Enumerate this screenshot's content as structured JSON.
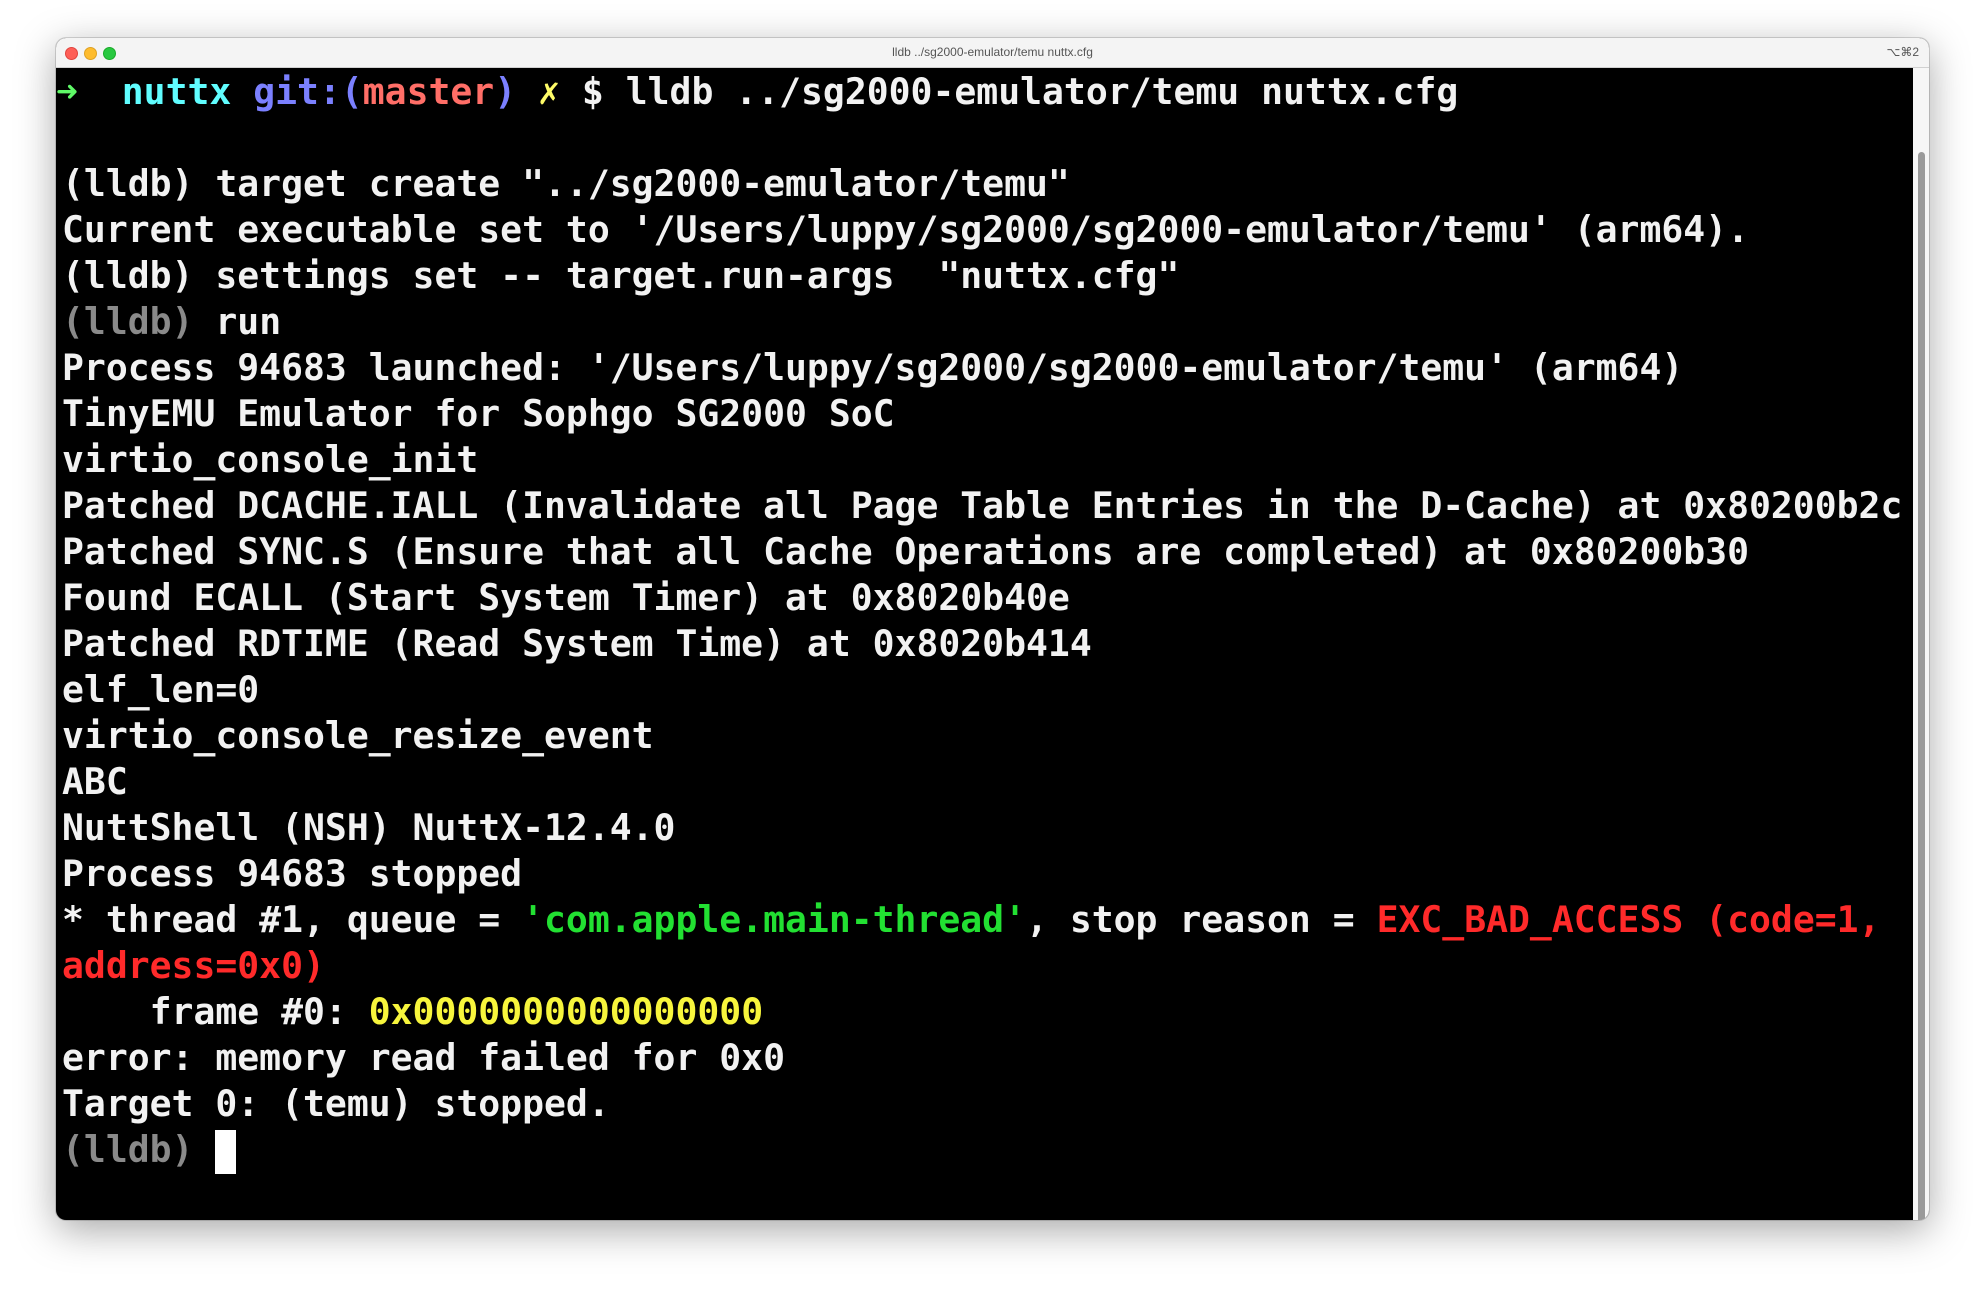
{
  "window": {
    "title": "lldb ../sg2000-emulator/temu nuttx.cfg",
    "shortcut": "⌥⌘2"
  },
  "colors": {
    "prompt_arrow": "#5ff967",
    "dir": "#60fdff",
    "git": "#7b80ff",
    "branch": "#ff6e67",
    "dirty": "#fefb67",
    "dim": "#8a8a8a",
    "string": "#22e032",
    "error": "#ff2a2a",
    "address": "#f7f53c"
  },
  "prompt": {
    "arrow": "➜",
    "dir": "nuttx",
    "git_open": "git:(",
    "branch": "master",
    "git_close": ")",
    "dirty": "✗",
    "command": "$ lldb ../sg2000-emulator/temu nuttx.cfg"
  },
  "lines": [
    "(lldb) target create \"../sg2000-emulator/temu\"",
    "Current executable set to '/Users/luppy/sg2000/sg2000-emulator/temu' (arm64).",
    "(lldb) settings set -- target.run-args  \"nuttx.cfg\""
  ],
  "run_line": {
    "prompt": "(lldb)",
    "cmd": " run"
  },
  "output": [
    "Process 94683 launched: '/Users/luppy/sg2000/sg2000-emulator/temu' (arm64)",
    "TinyEMU Emulator for Sophgo SG2000 SoC",
    "virtio_console_init",
    "Patched DCACHE.IALL (Invalidate all Page Table Entries in the D-Cache) at 0x80200b2c",
    "Patched SYNC.S (Ensure that all Cache Operations are completed) at 0x80200b30",
    "Found ECALL (Start System Timer) at 0x8020b40e",
    "Patched RDTIME (Read System Time) at 0x8020b414",
    "elf_len=0",
    "virtio_console_resize_event",
    "ABC",
    "NuttShell (NSH) NuttX-12.4.0",
    "Process 94683 stopped"
  ],
  "thread_line": {
    "pre": "* thread #1, queue = ",
    "queue": "'com.apple.main-thread'",
    "mid": ", stop reason = ",
    "reason": "EXC_BAD_ACCESS (code=1,",
    "reason_cont": "address=0x0)"
  },
  "frame_line": {
    "pre": "    frame #0: ",
    "addr": "0x0000000000000000"
  },
  "tail": [
    "error: memory read failed for 0x0",
    "Target 0: (temu) stopped."
  ],
  "final_prompt": "(lldb) "
}
